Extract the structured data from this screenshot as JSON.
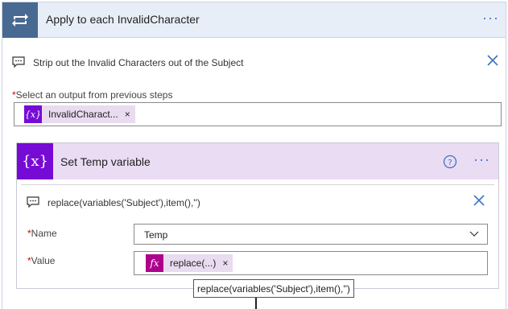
{
  "loop": {
    "title": "Apply to each InvalidCharacter",
    "more": "···",
    "comment": "Strip out the Invalid Characters out of the Subject",
    "select_output": {
      "required_mark": "*",
      "label": "Select an output from previous steps",
      "token_label": "InvalidCharact...",
      "token_icon": "{x}",
      "token_remove": "×"
    }
  },
  "action": {
    "title": "Set Temp variable",
    "icon_text": "{x}",
    "more": "···",
    "comment": "replace(variables('Subject'),item(),'')",
    "name_field": {
      "required_mark": "*",
      "label": "Name",
      "value": "Temp"
    },
    "value_field": {
      "required_mark": "*",
      "label": "Value",
      "token_label": "replace(...)",
      "token_icon": "fx",
      "token_remove": "×"
    }
  },
  "tooltip": "replace(variables('Subject'),item(),'')",
  "icons": {
    "loop": "loop-arrows-icon",
    "comment": "comment-icon",
    "close": "close-icon",
    "help": "help-circle-icon",
    "chevron": "chevron-down-icon"
  },
  "colors": {
    "loop_header_bg": "#e8eef7",
    "loop_icon_bg": "#486991",
    "variable_header_bg": "#eadcf3",
    "variable_icon_bg": "#770bd6",
    "expression_icon_bg": "#ad008c",
    "accent_blue": "#3d74c6"
  }
}
